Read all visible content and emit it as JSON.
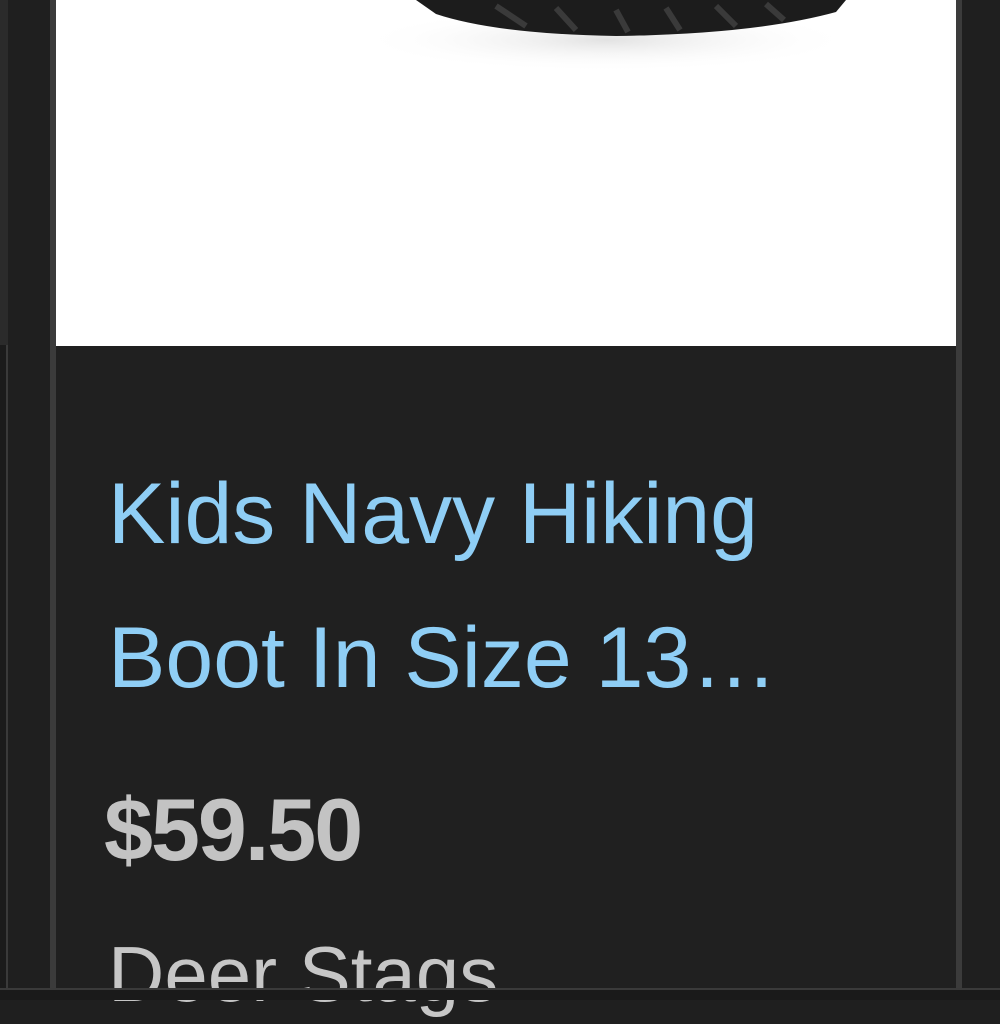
{
  "product": {
    "title_line1": "Kids Navy Hiking",
    "title_line2": "Boot In Size 13…",
    "price": "$59.50",
    "brand": "Deer Stags",
    "image_icon": "boot-photo"
  },
  "colors": {
    "background": "#1f1f1f",
    "link": "#8fcef5",
    "price": "#c3c3c3",
    "image_bg": "#ffffff"
  }
}
